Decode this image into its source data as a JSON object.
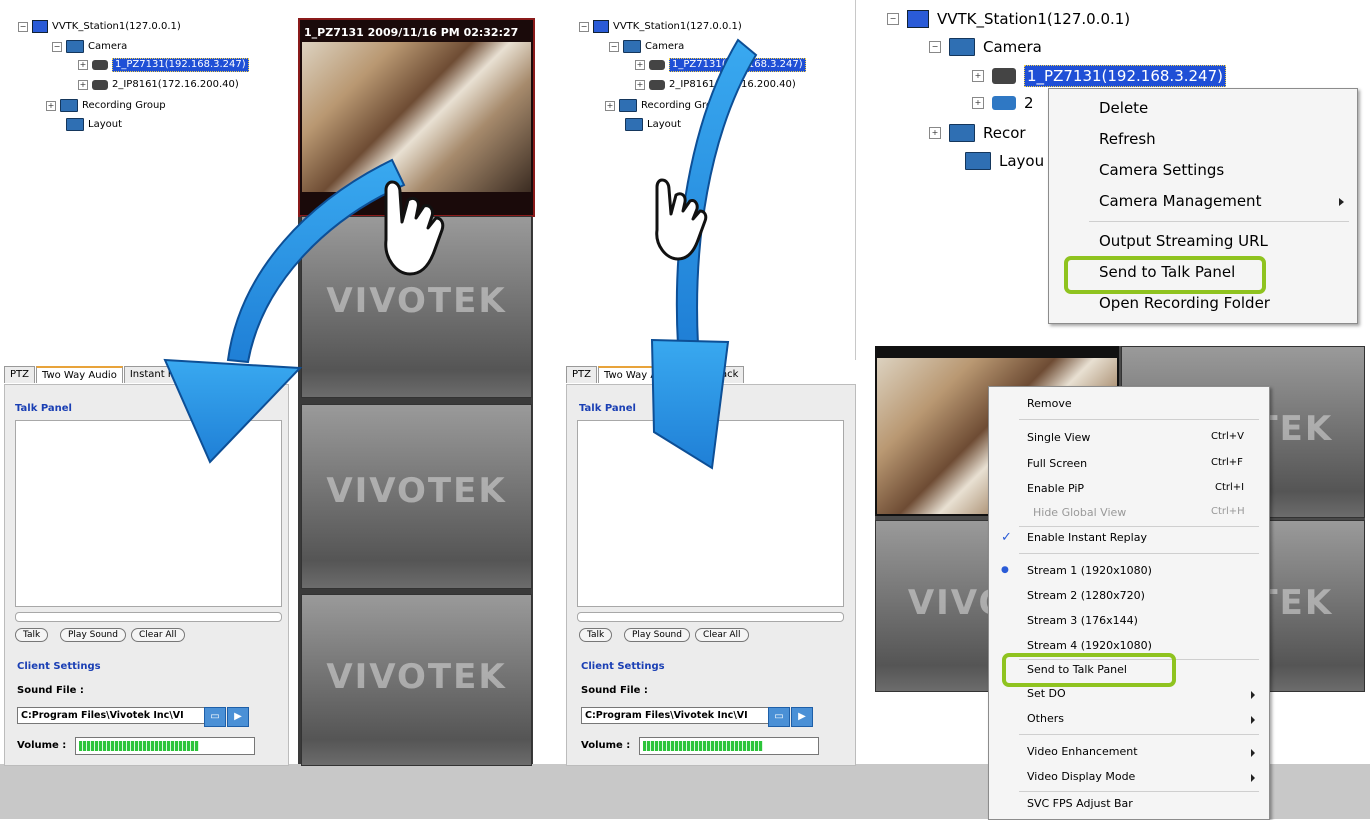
{
  "tree": {
    "station": "VVTK_Station1(127.0.0.1)",
    "camera_folder": "Camera",
    "cam1": "1_PZ7131(192.168.3.247)",
    "cam2": "2_IP8161(172.16.200.40)",
    "recording_group": "Recording Group",
    "layout": "Layout"
  },
  "tree_large": {
    "station": "VVTK_Station1(127.0.0.1)",
    "camera_folder": "Camera",
    "cam1": "1_PZ7131(192.168.3.247)",
    "cam2_partial": "2",
    "recording_partial": "Recor",
    "layout_partial": "Layou"
  },
  "tabs": [
    "PTZ",
    "Two Way Audio",
    "Instant Pl"
  ],
  "tabs_right": [
    "PTZ",
    "Two Way A",
    "tant Playback"
  ],
  "talk_panel": {
    "title": "Talk Panel",
    "buttons": [
      "Talk",
      "Play Sound",
      "Clear All"
    ],
    "client_settings": "Client Settings",
    "sound_file_label": "Sound File :",
    "sound_file_value": "C:Program Files\\Vivotek Inc\\VI",
    "volume_label": "Volume :",
    "volume_level": 0.7
  },
  "video": {
    "osd": "1_PZ7131 2009/11/16 PM 02:32:27",
    "logo": "VIVOTEK"
  },
  "tree_menu": {
    "items": [
      "Delete",
      "Refresh",
      "Camera Settings",
      "Camera Management",
      "Output Streaming URL",
      "Send to Talk Panel",
      "Open Recording Folder"
    ],
    "highlighted": "Send to Talk Panel"
  },
  "video_menu": {
    "items": [
      {
        "label": "Remove",
        "shortcut": ""
      },
      {
        "label": "Single View",
        "shortcut": "Ctrl+V"
      },
      {
        "label": "Full Screen",
        "shortcut": "Ctrl+F"
      },
      {
        "label": "Enable PiP",
        "shortcut": "Ctrl+I"
      },
      {
        "label": "Hide Global View",
        "shortcut": "Ctrl+H"
      },
      {
        "label": "Enable Instant Replay",
        "shortcut": ""
      },
      {
        "label": "Stream 1 (1920x1080)",
        "shortcut": ""
      },
      {
        "label": "Stream 2 (1280x720)",
        "shortcut": ""
      },
      {
        "label": "Stream 3 (176x144)",
        "shortcut": ""
      },
      {
        "label": "Stream 4 (1920x1080)",
        "shortcut": ""
      },
      {
        "label": "Send to Talk Panel",
        "shortcut": ""
      },
      {
        "label": "Set DO",
        "shortcut": ""
      },
      {
        "label": "Others",
        "shortcut": ""
      },
      {
        "label": "Video Enhancement",
        "shortcut": ""
      },
      {
        "label": "Video Display Mode",
        "shortcut": ""
      },
      {
        "label": "SVC FPS Adjust Bar",
        "shortcut": ""
      }
    ],
    "check_mark": "✓",
    "radio_mark": "●"
  },
  "colors": {
    "highlight": "#8fc31f",
    "arrow": "#1f8fe0",
    "selection": "#1f4fd6"
  }
}
